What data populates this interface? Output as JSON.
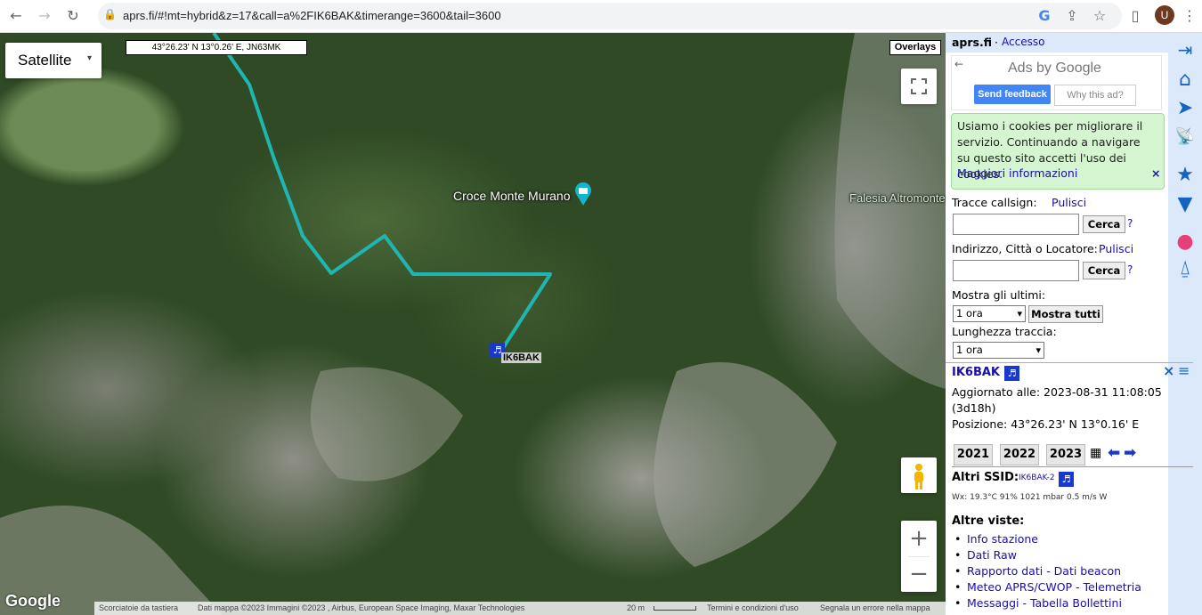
{
  "browser": {
    "url": "aprs.fi/#!mt=hybrid&z=17&call=a%2FIK6BAK&timerange=3600&tail=3600",
    "avatar_letter": "U"
  },
  "map": {
    "map_type": "Satellite",
    "cursor_coords": "43°26.23' N 13°0.26' E, JN63MK",
    "overlays_label": "Overlays",
    "poi": "Croce Monte Murano",
    "place_label": "Falesia Altromonte",
    "station_label": "IK6BAK",
    "google_logo": "Google",
    "attribution": {
      "shortcuts": "Scorciatoie da tastiera",
      "map_data": "Dati mappa ©2023 Immagini ©2023 , Airbus, European Space Imaging, Maxar Technologies",
      "scale": "20 m",
      "terms": "Termini e condizioni d'uso",
      "report": "Segnala un errore nella mappa"
    },
    "zoom_in": "+",
    "zoom_out": "−"
  },
  "sidebar": {
    "site": "aprs.fi",
    "login": "Accesso",
    "ad": {
      "title": "Ads by Google",
      "send_feedback": "Send feedback",
      "why": "Why this ad?"
    },
    "cookie": {
      "text": "Usiamo i cookies per migliorare il servizio. Continuando a navigare su questo sito accetti l'uso dei cookies.",
      "more": "Maggiori informazioni"
    },
    "track_label": "Tracce callsign:",
    "clear1": "Pulisci",
    "search1": "Cerca",
    "address_label": "Indirizzo, Città o Locatore:",
    "clear2": "Pulisci",
    "search2": "Cerca",
    "help": "?",
    "show_last": "Mostra gli ultimi:",
    "show_last_value": "1 ora",
    "show_all": "Mostra tutti",
    "track_length": "Lunghezza traccia:",
    "track_length_value": "1 ora",
    "station": {
      "callsign": "IK6BAK",
      "updated": "Aggiornato alle: 2023-08-31 11:08:05",
      "ago": "(3d18h)",
      "position": "Posizione: 43°26.23' N 13°0.16' E"
    },
    "years": [
      "2021",
      "2022",
      "2023"
    ],
    "other_ssid_label": "Altri SSID:",
    "other_ssid": "IK6BAK-2",
    "wx": "Wx: 19.3°C 91% 1021 mbar 0.5 m/s W",
    "other_views": "Altre viste:",
    "links": [
      "Info stazione",
      "Dati Raw",
      "Rapporto dati - Dati beacon",
      "Meteo APRS/CWOP - Telemetria",
      "Messaggi - Tabella Bollettini"
    ]
  }
}
